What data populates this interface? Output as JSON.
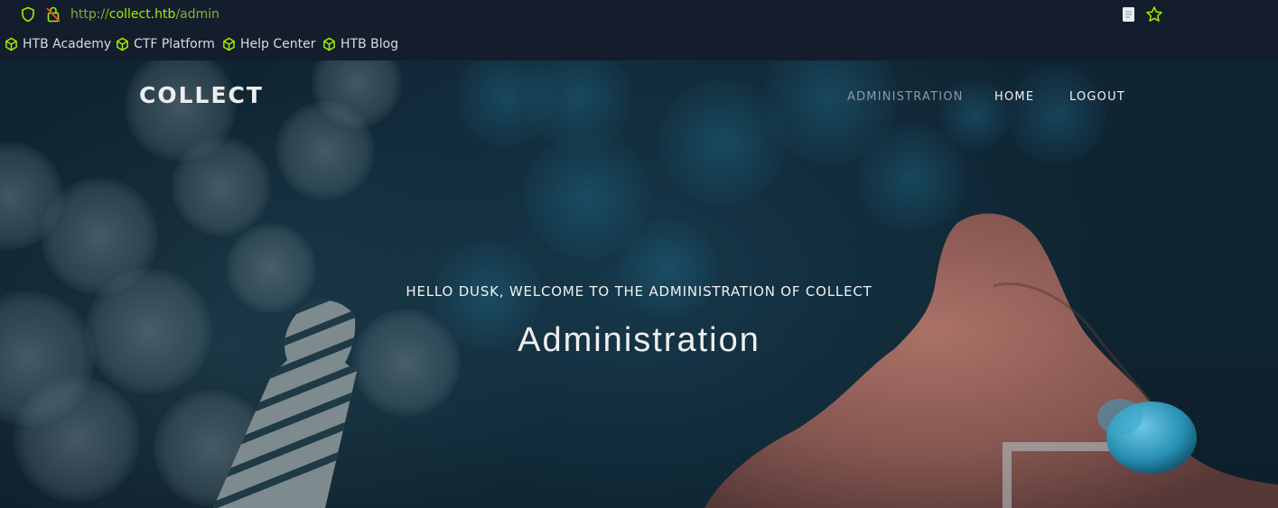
{
  "browser": {
    "url_scheme": "http://",
    "url_host": "collect.htb",
    "url_path": "/admin",
    "icons": [
      "shield-icon",
      "insecure-lock-icon",
      "reader-mode-icon",
      "bookmark-star-icon"
    ],
    "bookmarks": [
      {
        "label": "HTB Academy",
        "icon": "cube-icon"
      },
      {
        "label": "CTF Platform",
        "icon": "cube-icon"
      },
      {
        "label": "Help Center",
        "icon": "cube-icon"
      },
      {
        "label": "HTB Blog",
        "icon": "cube-icon"
      }
    ],
    "colors": {
      "chrome_bg": "#141d2b",
      "accent": "#9fef00"
    }
  },
  "site": {
    "brand": "COLLECT",
    "nav": [
      "ADMINISTRATION",
      "HOME",
      "LOGOUT"
    ],
    "welcome": "HELLO DUSK, WELCOME TO THE ADMINISTRATION OF COLLECT",
    "headline": "Administration"
  }
}
